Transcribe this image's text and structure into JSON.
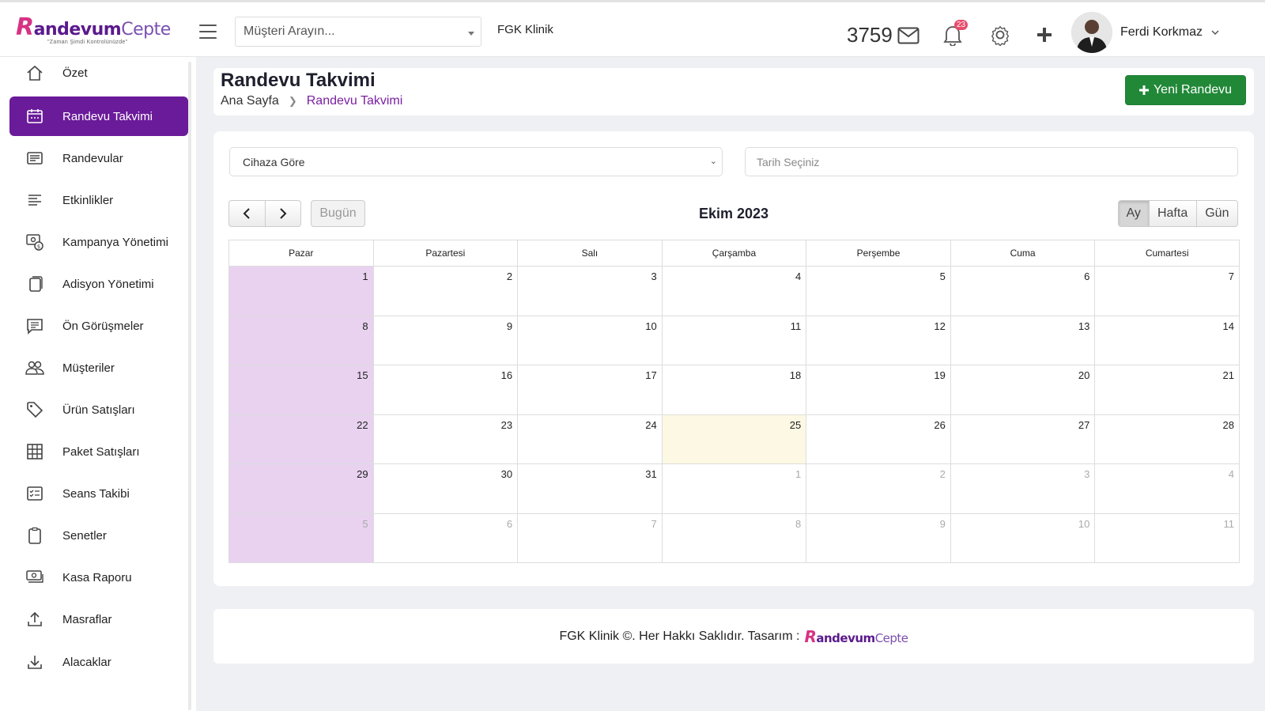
{
  "brand": {
    "logo_initial": "R",
    "logo_main": "andevum",
    "logo_light": "Cepte",
    "tagline": "\"Zaman Şimdi Kontrolünüzde\""
  },
  "header": {
    "search_placeholder": "Müşteri Arayın...",
    "clinic": "FGK Klinik",
    "sms_count": "3759",
    "notification_count": "23",
    "user_name": "Ferdi Korkmaz"
  },
  "sidebar": {
    "items": [
      {
        "label": "Özet",
        "icon": "home-icon"
      },
      {
        "label": "Randevu Takvimi",
        "icon": "calendar-icon",
        "active": true
      },
      {
        "label": "Randevular",
        "icon": "list-icon"
      },
      {
        "label": "Etkinlikler",
        "icon": "align-left-icon"
      },
      {
        "label": "Kampanya Yönetimi",
        "icon": "money-icon"
      },
      {
        "label": "Adisyon Yönetimi",
        "icon": "copy-icon"
      },
      {
        "label": "Ön Görüşmeler",
        "icon": "message-icon"
      },
      {
        "label": "Müşteriler",
        "icon": "users-icon"
      },
      {
        "label": "Ürün Satışları",
        "icon": "tag-icon"
      },
      {
        "label": "Paket Satışları",
        "icon": "grid-icon"
      },
      {
        "label": "Seans Takibi",
        "icon": "checklist-icon"
      },
      {
        "label": "Senetler",
        "icon": "clipboard-icon"
      },
      {
        "label": "Kasa Raporu",
        "icon": "cash-icon"
      },
      {
        "label": "Masraflar",
        "icon": "upload-icon"
      },
      {
        "label": "Alacaklar",
        "icon": "download-icon"
      }
    ]
  },
  "page": {
    "title": "Randevu Takvimi",
    "breadcrumb_home": "Ana Sayfa",
    "breadcrumb_current": "Randevu Takvimi",
    "new_button": "Yeni Randevu"
  },
  "filters": {
    "device_select": "Cihaza Göre",
    "date_placeholder": "Tarih Seçiniz"
  },
  "calendar": {
    "today_label": "Bugün",
    "month_title": "Ekim 2023",
    "views": [
      "Ay",
      "Hafta",
      "Gün"
    ],
    "active_view": "Ay",
    "weekdays": [
      "Pazar",
      "Pazartesi",
      "Salı",
      "Çarşamba",
      "Perşembe",
      "Cuma",
      "Cumartesi"
    ],
    "weeks": [
      [
        "1",
        "2",
        "3",
        "4",
        "5",
        "6",
        "7"
      ],
      [
        "8",
        "9",
        "10",
        "11",
        "12",
        "13",
        "14"
      ],
      [
        "15",
        "16",
        "17",
        "18",
        "19",
        "20",
        "21"
      ],
      [
        "22",
        "23",
        "24",
        "25",
        "26",
        "27",
        "28"
      ],
      [
        "29",
        "30",
        "31",
        "1",
        "2",
        "3",
        "4"
      ],
      [
        "5",
        "6",
        "7",
        "8",
        "9",
        "10",
        "11"
      ]
    ],
    "today": "25",
    "colors": {
      "sunday": "#e8d2f0",
      "today": "#fcf8e3",
      "accent": "#6a1b9a",
      "new_button": "#218838"
    }
  },
  "footer": {
    "text": "FGK Klinik ©. Her Hakkı Saklıdır. Tasarım :"
  }
}
